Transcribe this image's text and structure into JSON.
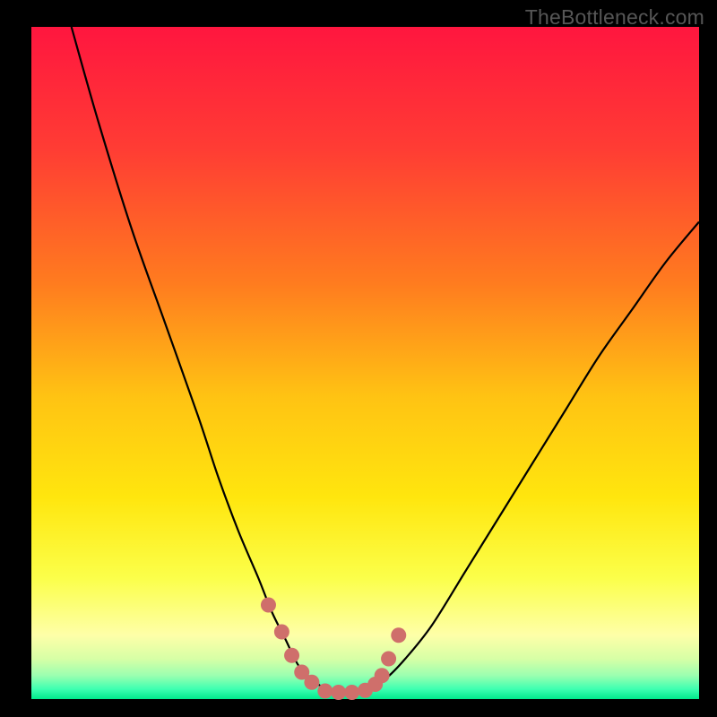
{
  "watermark": "TheBottleneck.com",
  "colors": {
    "background": "#000000",
    "curve": "#000000",
    "markers": "#cf6f6b",
    "gradient_stops": [
      {
        "offset": 0.0,
        "color": "#ff163f"
      },
      {
        "offset": 0.18,
        "color": "#ff3c34"
      },
      {
        "offset": 0.38,
        "color": "#ff7b1f"
      },
      {
        "offset": 0.55,
        "color": "#ffc313"
      },
      {
        "offset": 0.7,
        "color": "#ffe60e"
      },
      {
        "offset": 0.82,
        "color": "#fbff4a"
      },
      {
        "offset": 0.905,
        "color": "#feffa8"
      },
      {
        "offset": 0.94,
        "color": "#d7ffa6"
      },
      {
        "offset": 0.965,
        "color": "#9bffb0"
      },
      {
        "offset": 0.985,
        "color": "#3effb1"
      },
      {
        "offset": 1.0,
        "color": "#00e98c"
      }
    ]
  },
  "chart_data": {
    "type": "line",
    "title": "",
    "xlabel": "",
    "ylabel": "",
    "xlim": [
      0,
      100
    ],
    "ylim": [
      0,
      100
    ],
    "series": [
      {
        "name": "bottleneck-curve",
        "x": [
          6,
          10,
          15,
          20,
          25,
          28,
          31,
          34,
          36,
          38,
          40,
          42,
          44,
          46,
          48,
          50,
          53,
          56,
          60,
          65,
          70,
          75,
          80,
          85,
          90,
          95,
          100
        ],
        "y": [
          100,
          86,
          70,
          56,
          42,
          33,
          25,
          18,
          13,
          9,
          5,
          3,
          1.5,
          1,
          1,
          1.5,
          3,
          6,
          11,
          19,
          27,
          35,
          43,
          51,
          58,
          65,
          71
        ]
      }
    ],
    "markers": {
      "name": "highlight-points",
      "x": [
        35.5,
        37.5,
        39,
        40.5,
        42,
        44,
        46,
        48,
        50,
        51.5,
        52.5,
        53.5,
        55
      ],
      "y": [
        14,
        10,
        6.5,
        4,
        2.5,
        1.2,
        1,
        1,
        1.3,
        2.2,
        3.5,
        6,
        9.5
      ]
    }
  }
}
